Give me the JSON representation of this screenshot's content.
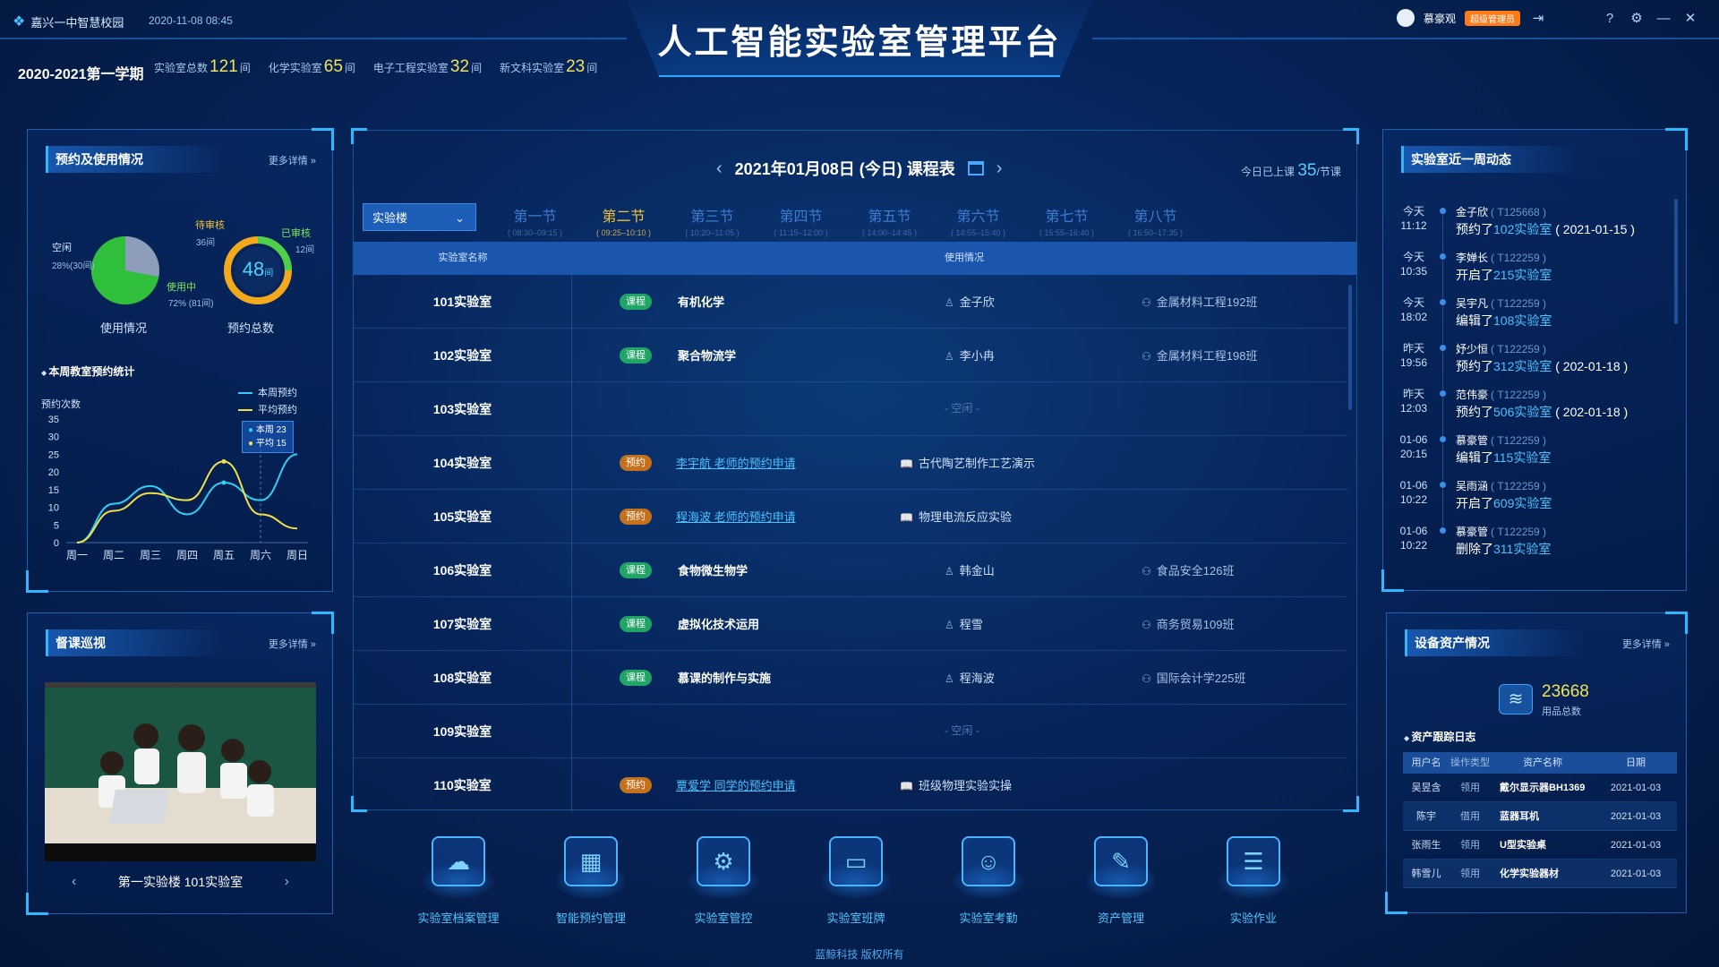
{
  "header": {
    "school": "嘉兴一中智慧校园",
    "datetime": "2020-11-08  08:45",
    "title": "人工智能实验室管理平台",
    "term": "2020-2021第一学期",
    "stats": [
      {
        "label": "实验室总数",
        "value": "121",
        "unit": "间"
      },
      {
        "label": "化学实验室",
        "value": "65",
        "unit": "间"
      },
      {
        "label": "电子工程实验室",
        "value": "32",
        "unit": "间"
      },
      {
        "label": "新文科实验室",
        "value": "23",
        "unit": "间"
      }
    ],
    "user_name": "慕豪观",
    "role_badge": "超级管理员"
  },
  "usage_panel": {
    "title": "预约及使用情况",
    "more": "更多详情 »",
    "idle_label": "空闲",
    "idle_value": "28%(30间)",
    "using_label": "使用中",
    "using_value": "72% (81间)",
    "caption_left": "使用情况",
    "pending_label": "待审核",
    "pending_value": "36间",
    "approved_label": "已审核",
    "approved_value": "12间",
    "gauge_value": "48",
    "gauge_unit": "间",
    "caption_right": "预约总数",
    "using_fraction": 0.72,
    "approved_fraction": 0.25
  },
  "weekly": {
    "title": "本周教室预约统计",
    "ylabel": "预约次数",
    "legend_week": "本周预约",
    "legend_avg": "平均预约",
    "tooltip_week": "本周 23",
    "tooltip_avg": "平均 15"
  },
  "chart_data": {
    "type": "line",
    "categories": [
      "周一",
      "周二",
      "周三",
      "周四",
      "周五",
      "周六",
      "周日"
    ],
    "series": [
      {
        "name": "本周预约",
        "values": [
          0,
          11,
          16,
          8,
          17,
          12,
          25
        ],
        "color": "#2fd0f5"
      },
      {
        "name": "平均预约",
        "values": [
          0,
          9,
          14,
          12,
          23,
          8,
          4
        ],
        "color": "#f2e04a"
      }
    ],
    "ylabel": "预约次数",
    "ylim": [
      0,
      35
    ],
    "yticks": [
      "35",
      "30",
      "25",
      "20",
      "15",
      "10",
      "5",
      "0"
    ],
    "legend": "top-right"
  },
  "patrol": {
    "title": "督课巡视",
    "more": "更多详情 »",
    "location": "第一实验楼  101实验室"
  },
  "schedule": {
    "date": "2021年01月08日 (今日) 课程表",
    "today_prefix": "今日已上课",
    "today_count": "35",
    "today_unit": "/节课",
    "building": "实验楼",
    "periods": [
      {
        "name": "第一节",
        "time": "( 08:30–09:15 )"
      },
      {
        "name": "第二节",
        "time": "( 09:25–10:10 )"
      },
      {
        "name": "第三节",
        "time": "( 10:20–11:05 )"
      },
      {
        "name": "第四节",
        "time": "( 11:15–12:00 )"
      },
      {
        "name": "第五节",
        "time": "( 14:00–14:45 )"
      },
      {
        "name": "第六节",
        "time": "( 14:55–15:40 )"
      },
      {
        "name": "第七节",
        "time": "( 15:55–16:40 )"
      },
      {
        "name": "第八节",
        "time": "( 16:50–17:35 )"
      }
    ],
    "col_room": "实验室名称",
    "col_usage": "使用情况",
    "idle_text": "- 空闲 -",
    "rows": [
      {
        "room": "101实验室",
        "tag": "课程",
        "subject": "有机化学",
        "teacher": "金子欣",
        "klass": "金属材料工程192班"
      },
      {
        "room": "102实验室",
        "tag": "课程",
        "subject": "聚合物流学",
        "teacher": "李小冉",
        "klass": "金属材料工程198班"
      },
      {
        "room": "103实验室"
      },
      {
        "room": "104实验室",
        "tag": "预约",
        "link": "李宇航 老师的预约申请",
        "exp": "古代陶艺制作工艺演示"
      },
      {
        "room": "105实验室",
        "tag": "预约",
        "link": "程海波 老师的预约申请",
        "exp": "物理电流反应实验"
      },
      {
        "room": "106实验室",
        "tag": "课程",
        "subject": "食物微生物学",
        "teacher": "韩金山",
        "klass": "食品安全126班"
      },
      {
        "room": "107实验室",
        "tag": "课程",
        "subject": "虚拟化技术运用",
        "teacher": "程雪",
        "klass": "商务贸易109班"
      },
      {
        "room": "108实验室",
        "tag": "课程",
        "subject": "慕课的制作与实施",
        "teacher": "程海波",
        "klass": "国际会计学225班"
      },
      {
        "room": "109实验室"
      },
      {
        "room": "110实验室",
        "tag": "预约",
        "link": "覃爱学 同学的预约申请",
        "exp": "班级物理实验实操"
      }
    ]
  },
  "modules": [
    {
      "label": "实验室档案管理",
      "icon": "cloud-archive-icon"
    },
    {
      "label": "智能预约管理",
      "icon": "booking-icon"
    },
    {
      "label": "实验室管控",
      "icon": "control-icon"
    },
    {
      "label": "实验室班牌",
      "icon": "signboard-icon"
    },
    {
      "label": "实验室考勤",
      "icon": "face-scan-icon"
    },
    {
      "label": "资产管理",
      "icon": "asset-icon"
    },
    {
      "label": "实验作业",
      "icon": "homework-icon"
    }
  ],
  "footer": "蓝鲸科技  版权所有",
  "activity": {
    "title": "实验室近一周动态",
    "items": [
      {
        "day": "今天",
        "time": "11:12",
        "who": "金子欣",
        "id": "( T125668 )",
        "verb": "预约了",
        "room": "102实验室",
        "extra": "( 2021-01-15 )"
      },
      {
        "day": "今天",
        "time": "10:35",
        "who": "李婵长",
        "id": "( T122259 )",
        "verb": "开启了",
        "room": "215实验室",
        "extra": ""
      },
      {
        "day": "今天",
        "time": "18:02",
        "who": "吴宇凡",
        "id": "( T122259 )",
        "verb": "编辑了",
        "room": "108实验室",
        "extra": ""
      },
      {
        "day": "昨天",
        "time": "19:56",
        "who": "妤少恒",
        "id": "( T122259 )",
        "verb": "预约了",
        "room": "312实验室",
        "extra": "( 202-01-18 )"
      },
      {
        "day": "昨天",
        "time": "12:03",
        "who": "范伟豪",
        "id": "( T122259 )",
        "verb": "预约了",
        "room": "506实验室",
        "extra": "( 202-01-18 )"
      },
      {
        "day": "01-06",
        "time": "20:15",
        "who": "慕豪管",
        "id": "( T122259 )",
        "verb": "编辑了",
        "room": "115实验室",
        "extra": ""
      },
      {
        "day": "01-06",
        "time": "10:22",
        "who": "吴雨涵",
        "id": "( T122259 )",
        "verb": "开启了",
        "room": "609实验室",
        "extra": ""
      },
      {
        "day": "01-06",
        "time": "10:22",
        "who": "慕豪管",
        "id": "( T122259 )",
        "verb": "删除了",
        "room": "311实验室",
        "extra": ""
      }
    ]
  },
  "assets": {
    "title": "设备资产情况",
    "more": "更多详情 »",
    "total": "23668",
    "total_label": "用品总数",
    "log_title": "资产跟踪日志",
    "headers": [
      "用户名",
      "操作类型",
      "资产名称",
      "日期"
    ],
    "rows": [
      [
        "吴昱含",
        "领用",
        "戴尔显示器BH1369",
        "2021-01-03"
      ],
      [
        "陈宇",
        "借用",
        "蓝器耳机",
        "2021-01-03"
      ],
      [
        "张雨生",
        "领用",
        "U型实验桌",
        "2021-01-03"
      ],
      [
        "韩雪儿",
        "领用",
        "化学实验器材",
        "2021-01-03"
      ]
    ]
  }
}
